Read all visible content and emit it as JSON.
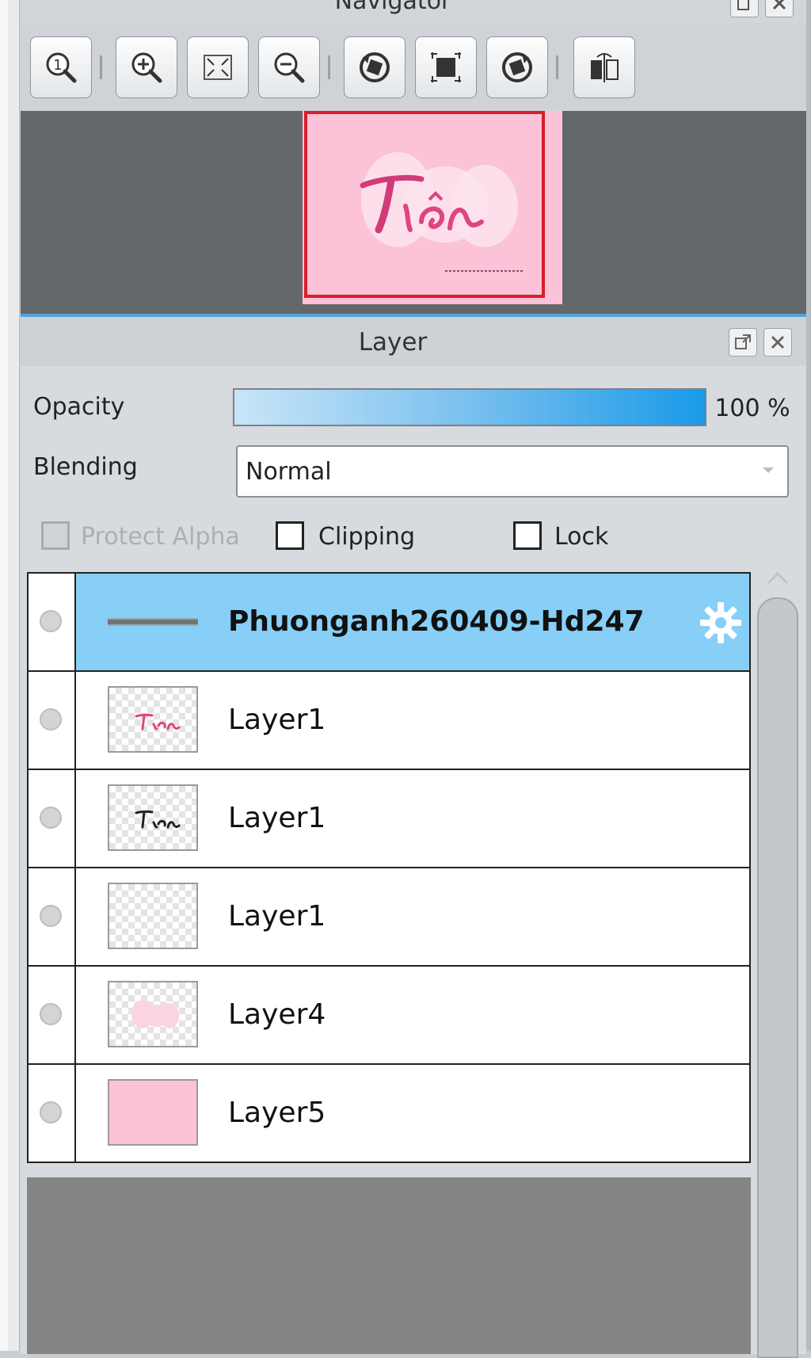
{
  "navigator": {
    "title": "Navigator",
    "toolbar_icons": [
      "zoom-actual-icon",
      "zoom-in-icon",
      "fit-screen-icon",
      "zoom-out-icon",
      "rotate-left-icon",
      "reset-view-icon",
      "rotate-right-icon",
      "flip-horizontal-icon"
    ]
  },
  "layer_panel": {
    "title": "Layer",
    "opacity_label": "Opacity",
    "opacity_value": "100 %",
    "opacity_percent": 100,
    "blending_label": "Blending",
    "blending_value": "Normal",
    "protect_alpha_label": "Protect Alpha",
    "clipping_label": "Clipping",
    "lock_label": "Lock",
    "layers": [
      {
        "name": "Phuonganh260409-Hd247",
        "selected": true
      },
      {
        "name": "Layer1",
        "selected": false
      },
      {
        "name": "Layer1",
        "selected": false
      },
      {
        "name": "Layer1",
        "selected": false
      },
      {
        "name": "Layer4",
        "selected": false
      },
      {
        "name": "Layer5",
        "selected": false
      }
    ]
  },
  "colors": {
    "selected_row": "#87cff7",
    "accent_line": "#4fa3d8",
    "frame_red": "#d91e2b",
    "canvas_pink": "#fbc2d8"
  }
}
